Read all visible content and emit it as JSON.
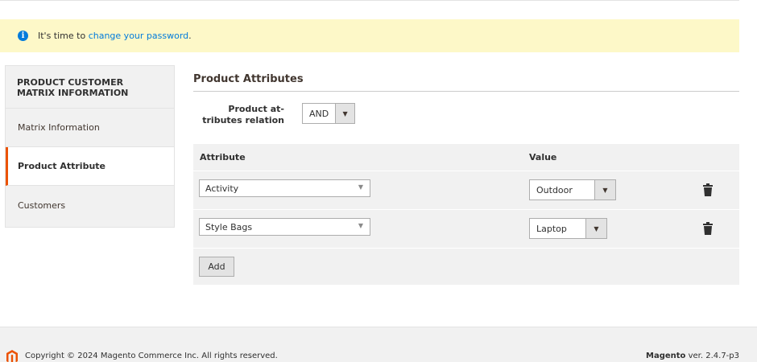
{
  "notice": {
    "text": "It's time to ",
    "link": "change your password",
    "suffix": "."
  },
  "sidebar": {
    "title": "PRODUCT CUSTOMER MATRIX INFORMATION",
    "items": [
      {
        "label": "Matrix Information",
        "active": false
      },
      {
        "label": "Product Attribute",
        "active": true
      },
      {
        "label": "Customers",
        "active": false
      }
    ]
  },
  "main": {
    "section_title": "Product Attributes",
    "relation_label": "Product at-\ntributes relation",
    "relation_value": "AND",
    "table": {
      "headers": {
        "attribute": "Attribute",
        "value": "Value"
      },
      "rows": [
        {
          "attribute": "Activity",
          "value": "Outdoor"
        },
        {
          "attribute": "Style Bags",
          "value": "Laptop"
        }
      ],
      "add_label": "Add"
    }
  },
  "footer": {
    "copyright": "Copyright © 2024 Magento Commerce Inc. All rights reserved.",
    "brand": "Magento",
    "version": " ver. 2.4.7-p3"
  },
  "colors": {
    "accent": "#eb5202",
    "link": "#007bdb",
    "notice_bg": "#fdf8c8"
  }
}
